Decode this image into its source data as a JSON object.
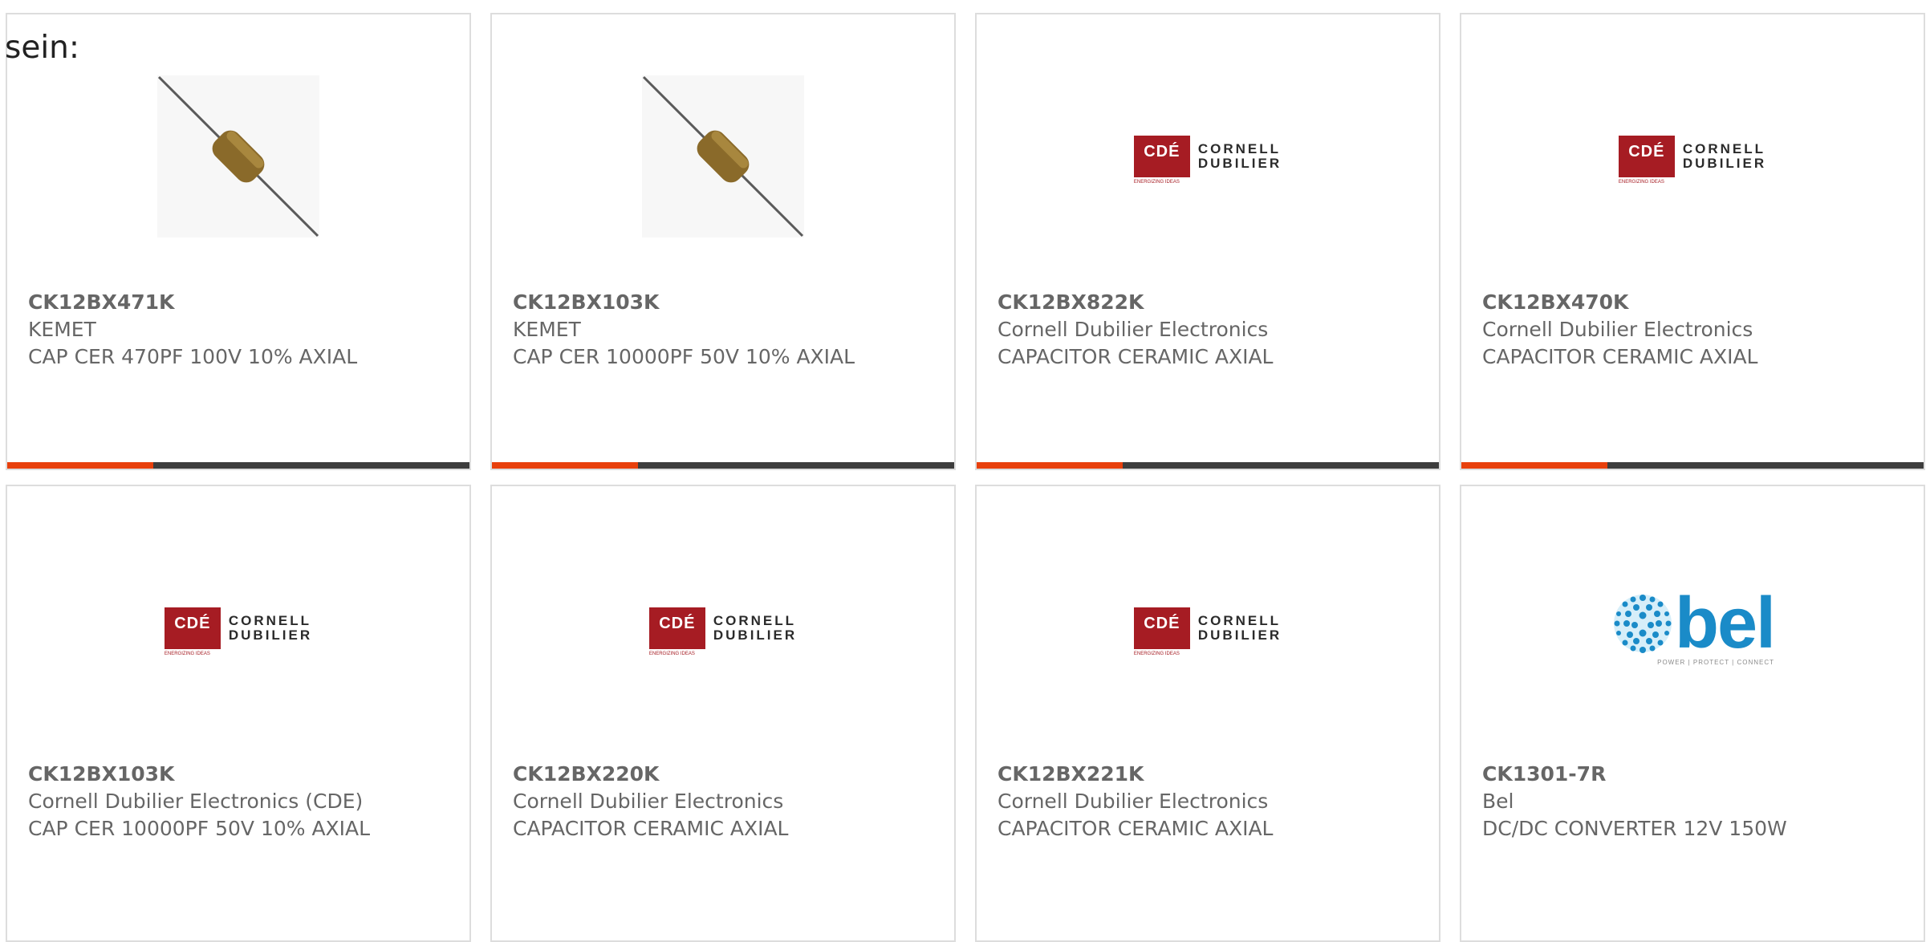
{
  "page": {
    "label": "sein:"
  },
  "colors": {
    "accent": "#e8400c",
    "bar": "#3d3d3d",
    "card_border": "#dddddd",
    "cde_red": "#a61c23",
    "bel_blue": "#1a8bc8"
  },
  "logos": {
    "cde": {
      "letters": "CDÉ",
      "tag": "ENERGIZING IDEAS",
      "word1": "CORNELL",
      "word2": "DUBILIER"
    },
    "bel": {
      "word": "bel",
      "tagline": "POWER | PROTECT | CONNECT"
    }
  },
  "products": [
    {
      "part_number": "CK12BX471K",
      "manufacturer": "KEMET",
      "description": "CAP CER 470PF 100V 10% AXIAL",
      "image": "axial-capacitor"
    },
    {
      "part_number": "CK12BX103K",
      "manufacturer": "KEMET",
      "description": "CAP CER 10000PF 50V 10% AXIAL",
      "image": "axial-capacitor"
    },
    {
      "part_number": "CK12BX822K",
      "manufacturer": "Cornell Dubilier Electronics",
      "description": "CAPACITOR CERAMIC AXIAL",
      "image": "cde-logo"
    },
    {
      "part_number": "CK12BX470K",
      "manufacturer": "Cornell Dubilier Electronics",
      "description": "CAPACITOR CERAMIC AXIAL",
      "image": "cde-logo"
    },
    {
      "part_number": "CK12BX103K",
      "manufacturer": "Cornell Dubilier Electronics (CDE)",
      "description": "CAP CER 10000PF 50V 10% AXIAL",
      "image": "cde-logo"
    },
    {
      "part_number": "CK12BX220K",
      "manufacturer": "Cornell Dubilier Electronics",
      "description": "CAPACITOR CERAMIC AXIAL",
      "image": "cde-logo"
    },
    {
      "part_number": "CK12BX221K",
      "manufacturer": "Cornell Dubilier Electronics",
      "description": "CAPACITOR CERAMIC AXIAL",
      "image": "cde-logo"
    },
    {
      "part_number": "CK1301-7R",
      "manufacturer": "Bel",
      "description": "DC/DC CONVERTER 12V 150W",
      "image": "bel-logo"
    }
  ]
}
